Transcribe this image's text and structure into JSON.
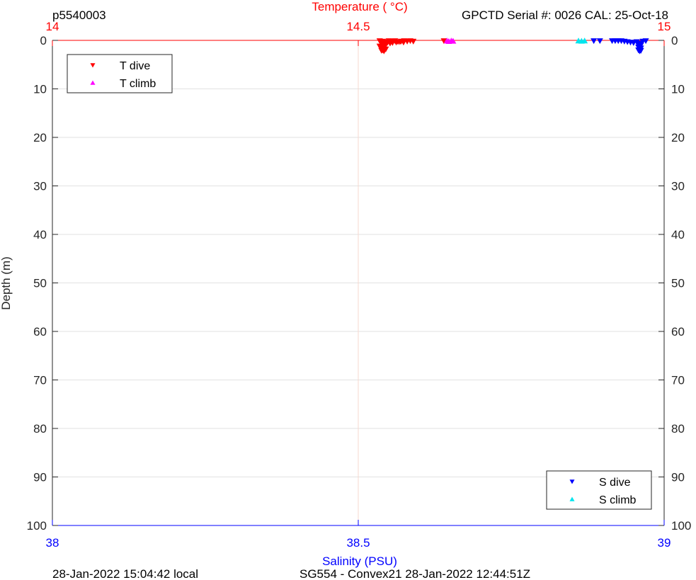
{
  "header": {
    "profile_id": "p5540003",
    "sensor_info": "GPCTD Serial #: 0026 CAL: 25-Oct-18"
  },
  "footer": {
    "local_time": "28-Jan-2022 15:04:42 local",
    "mission": "SG554 - Convex21 28-Jan-2022 12:44:51Z"
  },
  "chart_data": {
    "type": "scatter",
    "title": "",
    "ylabel": "Depth (m)",
    "ylim": [
      0,
      100
    ],
    "y_reversed": true,
    "y_ticks": [
      0,
      10,
      20,
      30,
      40,
      50,
      60,
      70,
      80,
      90,
      100
    ],
    "x_top": {
      "label": "Temperature (    °C)",
      "range": [
        14,
        15
      ],
      "ticks": [
        14,
        14.5,
        15
      ],
      "color": "#ff0000"
    },
    "x_bottom": {
      "label": "Salinity (PSU)",
      "range": [
        38,
        39
      ],
      "ticks": [
        38,
        38.5,
        39
      ],
      "color": "#0000ff"
    },
    "grid": true,
    "series": [
      {
        "name": "T dive",
        "axis": "top",
        "marker": "triangle-down",
        "color": "#ff0000",
        "points": [
          [
            14.535,
            0.1
          ],
          [
            14.54,
            0.2
          ],
          [
            14.545,
            0.3
          ],
          [
            14.55,
            0.1
          ],
          [
            14.555,
            0.2
          ],
          [
            14.56,
            0.1
          ],
          [
            14.565,
            0.3
          ],
          [
            14.57,
            0.2
          ],
          [
            14.575,
            0.1
          ],
          [
            14.58,
            0.2
          ],
          [
            14.585,
            0.1
          ],
          [
            14.59,
            0.2
          ],
          [
            14.538,
            0.5
          ],
          [
            14.542,
            0.7
          ],
          [
            14.545,
            0.9
          ],
          [
            14.54,
            1.0
          ],
          [
            14.535,
            1.2
          ],
          [
            14.538,
            1.4
          ],
          [
            14.542,
            1.6
          ],
          [
            14.545,
            1.8
          ],
          [
            14.54,
            2.0
          ],
          [
            14.538,
            2.1
          ],
          [
            14.542,
            2.2
          ],
          [
            14.548,
            0.4
          ],
          [
            14.552,
            0.6
          ],
          [
            14.556,
            0.5
          ],
          [
            14.562,
            0.4
          ],
          [
            14.568,
            0.3
          ],
          [
            14.574,
            0.4
          ],
          [
            14.64,
            0.1
          ]
        ]
      },
      {
        "name": "T climb",
        "axis": "top",
        "marker": "triangle-up",
        "color": "#ff00ff",
        "points": [
          [
            14.645,
            0.1
          ],
          [
            14.648,
            0.2
          ],
          [
            14.652,
            0.1
          ],
          [
            14.655,
            0.15
          ]
        ]
      },
      {
        "name": "S dive",
        "axis": "bottom",
        "marker": "triangle-down",
        "color": "#0000ff",
        "points": [
          [
            38.885,
            0.1
          ],
          [
            38.895,
            0.1
          ],
          [
            38.915,
            0.1
          ],
          [
            38.92,
            0.1
          ],
          [
            38.925,
            0.1
          ],
          [
            38.93,
            0.1
          ],
          [
            38.935,
            0.2
          ],
          [
            38.94,
            0.3
          ],
          [
            38.945,
            0.4
          ],
          [
            38.95,
            0.5
          ],
          [
            38.955,
            0.3
          ],
          [
            38.958,
            0.6
          ],
          [
            38.96,
            0.8
          ],
          [
            38.962,
            1.0
          ],
          [
            38.96,
            1.2
          ],
          [
            38.958,
            1.4
          ],
          [
            38.962,
            1.6
          ],
          [
            38.96,
            1.8
          ],
          [
            38.958,
            2.0
          ],
          [
            38.962,
            2.1
          ],
          [
            38.96,
            2.2
          ],
          [
            38.965,
            0.2
          ],
          [
            38.97,
            0.1
          ]
        ]
      },
      {
        "name": "S climb",
        "axis": "bottom",
        "marker": "triangle-up",
        "color": "#00e5ee",
        "points": [
          [
            38.86,
            0.1
          ],
          [
            38.865,
            0.15
          ],
          [
            38.87,
            0.1
          ]
        ]
      }
    ],
    "legends": [
      {
        "position": "top-left",
        "entries": [
          "T dive",
          "T climb"
        ]
      },
      {
        "position": "bottom-right",
        "entries": [
          "S dive",
          "S climb"
        ]
      }
    ]
  }
}
